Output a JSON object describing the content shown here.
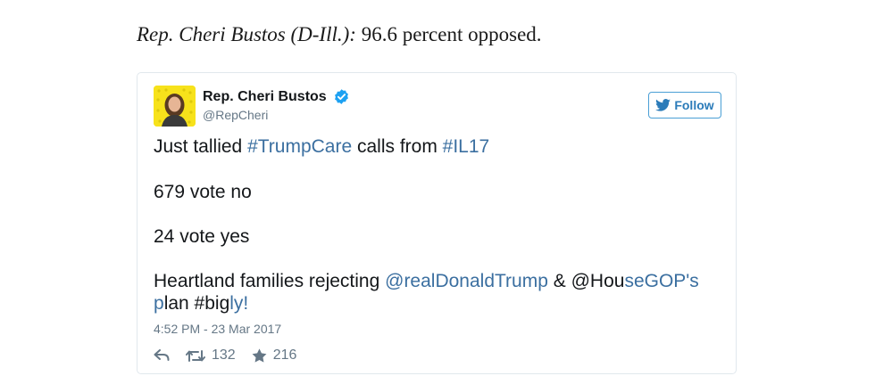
{
  "intro": {
    "lead": "Rep. Cheri Bustos (D-Ill.):",
    "rest": " 96.6 percent opposed."
  },
  "tweet": {
    "author_name": "Rep. Cheri Bustos",
    "handle": "@RepCheri",
    "follow_label": "Follow",
    "line1": {
      "a": "Just tallied ",
      "b": "#TrumpCare",
      "c": " calls from ",
      "d": "#IL17"
    },
    "line2": "679 vote no",
    "line3": "24 vote yes",
    "line4": {
      "a": "Heartland families rejecting ",
      "b": "@realDonaldTrump",
      "c": " & @Hou",
      "d": "seGOP's"
    },
    "line5": {
      "a": "p",
      "b": "lan #big",
      "c": "ly!"
    },
    "timestamp": "4:52 PM - 23 Mar 2017",
    "retweets": "132",
    "likes": "216"
  },
  "colors": {
    "link": "#3b6fa0",
    "follow_border": "#4a9fd5",
    "verified": "#1da1f2",
    "avatar_bg": "#f7e21b"
  },
  "icons": [
    "verified-badge-icon",
    "twitter-bird-icon",
    "reply-icon",
    "retweet-icon",
    "like-star-icon"
  ]
}
